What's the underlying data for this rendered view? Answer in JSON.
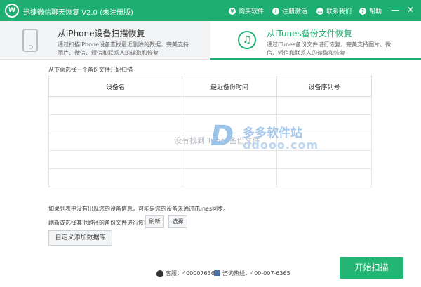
{
  "app": {
    "logo_text": "W",
    "title": "迅捷微信聊天恢复 V2.0 (未注册版)"
  },
  "titlebar": {
    "buy": "购买软件",
    "register": "注册激活",
    "contact": "联系我们",
    "help": "帮助",
    "minimize": "—",
    "close": "✕"
  },
  "modes": {
    "iphone": {
      "title": "从iPhone设备扫描恢复",
      "desc": "通过扫描iPhone设备查找最近删除的数据，完美支持图片、微信、短信和联系人的读取和恢复"
    },
    "itunes": {
      "title": "从iTunes备份文件恢复",
      "desc": "通过iTunes备份文件进行恢复，完美支持图片、微信、短信和联系人的读取和恢复",
      "icon_glyph": "♫"
    }
  },
  "instruction": "从下面选择一个备份文件开始扫描",
  "table": {
    "headers": [
      "设备名",
      "最近备份时间",
      "设备序列号"
    ],
    "empty_text": "没有找到iTunes备份文件"
  },
  "watermark": {
    "letter": "D",
    "name": "多多软件站",
    "url": "ddooo.com"
  },
  "hints": {
    "line1": "如果列表中没有出现您的设备信息，可能是您的设备未通过iTunes同步。",
    "line2": "刷新或选择其他路径的备份文件进行恢复。"
  },
  "buttons": {
    "refresh": "刷新",
    "select": "选择",
    "add_db": "自定义添加数据库",
    "start": "开始扫描"
  },
  "footer": {
    "qq": "客服：4000076365",
    "hotline": "咨询热线：400-007-6365"
  },
  "colors": {
    "accent": "#1fae72",
    "start_button": "#22b573"
  }
}
